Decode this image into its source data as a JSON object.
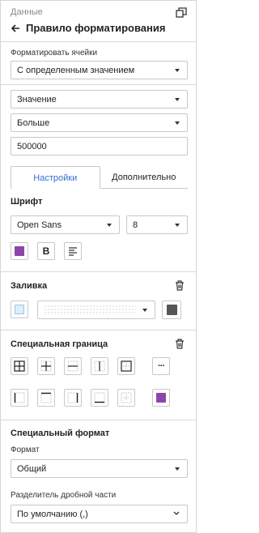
{
  "header": {
    "panel_title": "Данные",
    "rule_title": "Правило форматирования"
  },
  "format_cells": {
    "label": "Форматировать ячейки",
    "value": "С определенным значением"
  },
  "condition": {
    "field_value": "Значение",
    "operator_value": "Больше",
    "input_value": "500000"
  },
  "tabs": [
    {
      "label": "Настройки",
      "active": true
    },
    {
      "label": "Дополнительно",
      "active": false
    }
  ],
  "font": {
    "title": "Шрифт",
    "family": "Open Sans",
    "size": "8",
    "color": "#8e44ad",
    "bold_label": "B"
  },
  "fill": {
    "title": "Заливка",
    "color": "#dceefa",
    "pattern_color": "#555555"
  },
  "border": {
    "title": "Специальная граница",
    "color": "#8e44ad",
    "more_label": "···"
  },
  "special_format": {
    "title": "Специальный формат",
    "format_label": "Формат",
    "format_value": "Общий",
    "decimal_label": "Разделитель дробной части",
    "decimal_value": "По умолчанию (,)"
  }
}
